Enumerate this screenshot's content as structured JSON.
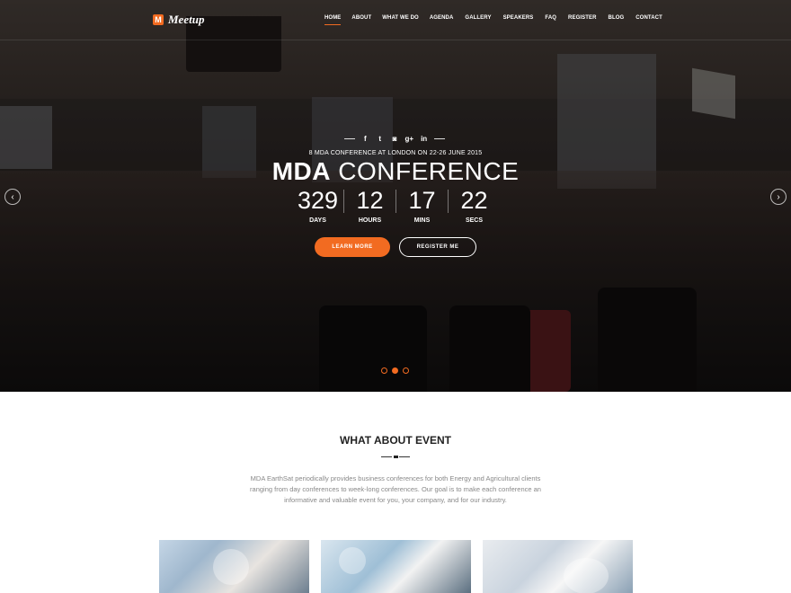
{
  "brand": {
    "logo_letter": "M",
    "name": "Meetup",
    "accent_color": "#f26b21"
  },
  "nav": {
    "items": [
      "HOME",
      "ABOUT",
      "WHAT WE DO",
      "AGENDA",
      "GALLERY",
      "SPEAKERS",
      "FAQ",
      "REGISTER",
      "BLOG",
      "CONTACT"
    ],
    "active": "HOME"
  },
  "hero": {
    "social_icons": [
      "facebook-icon",
      "twitter-icon",
      "instagram-icon",
      "google-plus-icon",
      "linkedin-icon"
    ],
    "social_glyphs": [
      "f",
      "t",
      "◙",
      "g+",
      "in"
    ],
    "subtitle": "8 MDA CONFERENCE AT LONDON ON 22-26 JUNE 2015",
    "title_bold": "MDA",
    "title_light": "CONFERENCE",
    "countdown": [
      {
        "value": "329",
        "label": "DAYS"
      },
      {
        "value": "12",
        "label": "HOURS"
      },
      {
        "value": "17",
        "label": "MINS"
      },
      {
        "value": "22",
        "label": "SECS"
      }
    ],
    "learn_more": "LEARN MORE",
    "register_me": "REGISTER ME",
    "arrow_left": "‹",
    "arrow_right": "›",
    "slides": 3,
    "active_slide": 2
  },
  "about": {
    "title": "WHAT ABOUT EVENT",
    "text": "MDA EarthSat periodically provides business conferences for both Energy and Agricultural clients ranging from day conferences to week-long conferences. Our goal is to make each conference an informative and valuable event for you, your company, and for our industry."
  }
}
